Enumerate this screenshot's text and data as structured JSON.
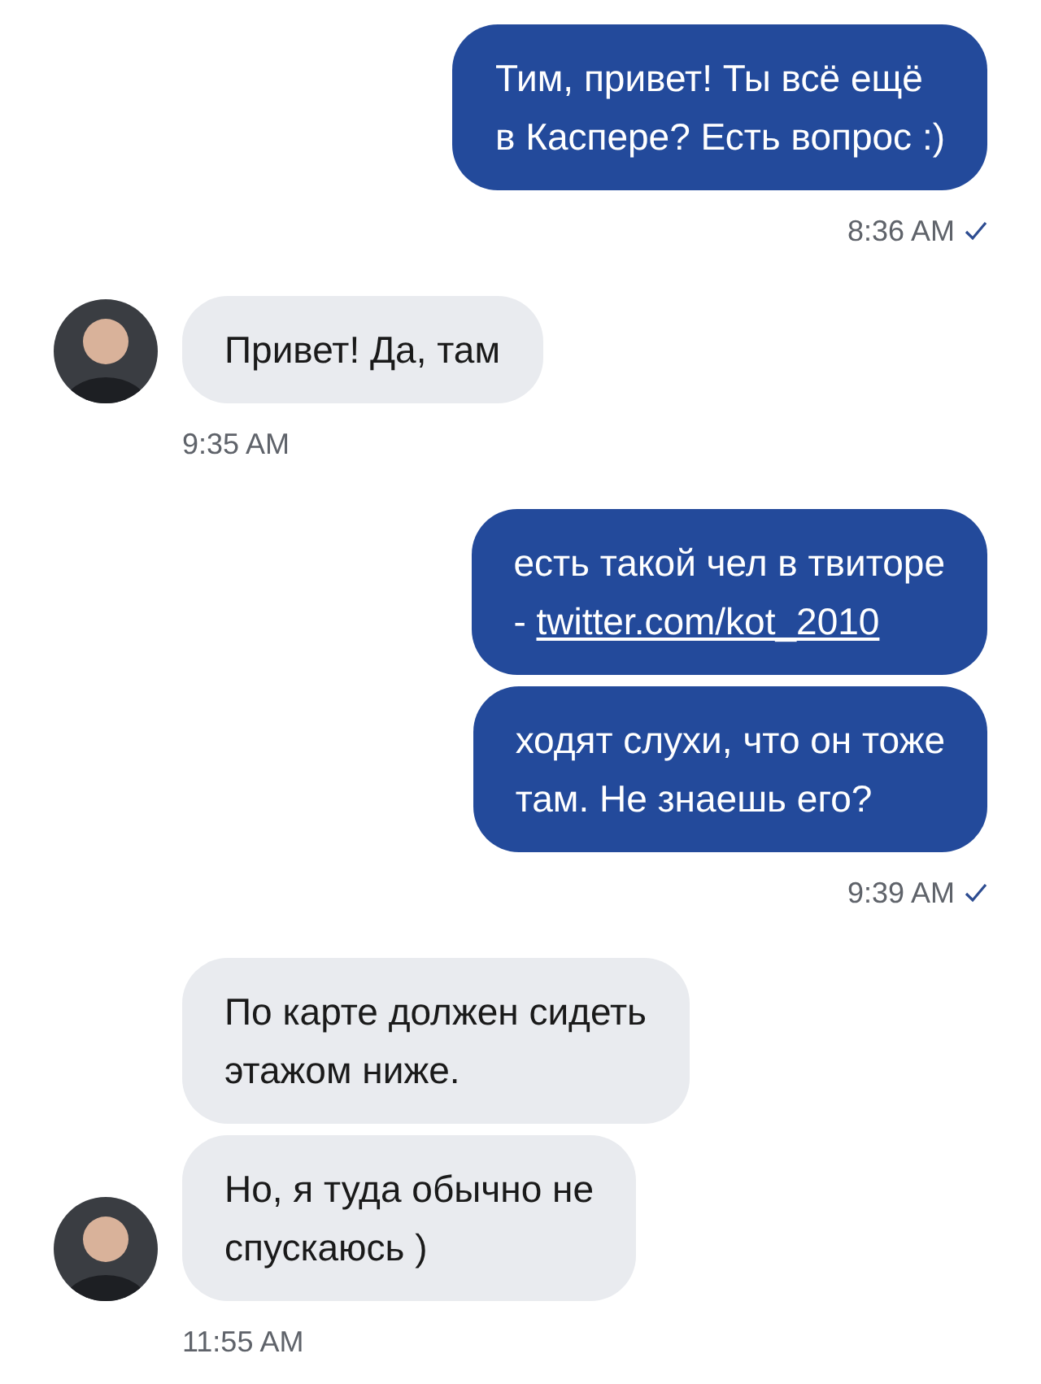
{
  "groups": [
    {
      "kind": "outgoing",
      "time": "8:36 AM",
      "read": true,
      "messages": [
        {
          "lines": [
            "Тим, привет! Ты всё ещё",
            "в Каспере? Есть вопрос :)"
          ]
        }
      ]
    },
    {
      "kind": "incoming",
      "time": "9:35 AM",
      "read": false,
      "messages": [
        {
          "lines": [
            "Привет! Да, там"
          ]
        }
      ]
    },
    {
      "kind": "outgoing",
      "time": "9:39 AM",
      "read": true,
      "messages": [
        {
          "lines": [
            "есть такой чел в твиторе",
            "- "
          ],
          "link": "twitter.com/kot_2010"
        },
        {
          "lines": [
            "ходят слухи, что он тоже",
            "там. Не знаешь его?"
          ]
        }
      ]
    },
    {
      "kind": "incoming",
      "time": "11:55 AM",
      "read": false,
      "messages": [
        {
          "lines": [
            "По карте должен сидеть",
            "этажом ниже."
          ]
        },
        {
          "lines": [
            "Но, я туда обычно не",
            "спускаюсь )"
          ]
        }
      ]
    }
  ]
}
